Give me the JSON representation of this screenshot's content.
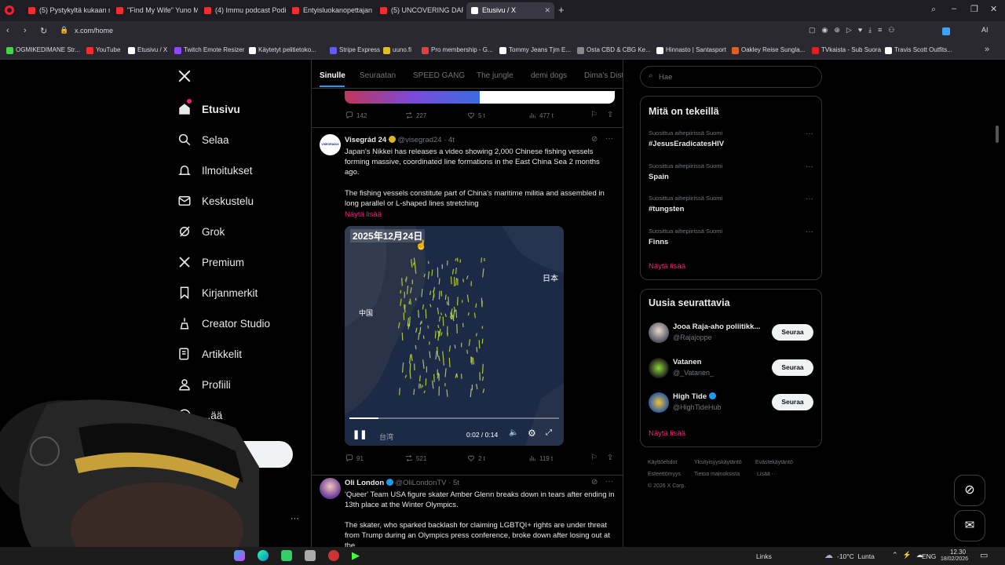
{
  "browser": {
    "tabs": [
      {
        "label": "(5) Pystykyltä kukaan noste",
        "color": "#ff2b2b"
      },
      {
        "label": "\"Find My Wife\" Yuno Mili",
        "color": "#ff2b2b"
      },
      {
        "label": "(4) Immu podcast Podim",
        "color": "#ff2b2b"
      },
      {
        "label": "Entyisluokanopettajan ark",
        "color": "#ff2b2b"
      },
      {
        "label": "(5) UNCOVERING DARK E",
        "color": "#ff2b2b"
      },
      {
        "label": "Etusivu / X",
        "color": "#ffffff"
      }
    ],
    "url": "x.com/home",
    "ai_label": "AI",
    "bookmarks": [
      {
        "label": "OGMIKEDIMANE Str...",
        "color": "#4ad14a"
      },
      {
        "label": "YouTube",
        "color": "#ff2b2b"
      },
      {
        "label": "Etusivu / X",
        "color": "#ffffff"
      },
      {
        "label": "Twitch Emote Resizer",
        "color": "#9146ff"
      },
      {
        "label": "Käytetyt pelitietoko...",
        "color": "#ffffff"
      },
      {
        "label": "Stripe Express",
        "color": "#635bff"
      },
      {
        "label": "uuno.fi",
        "color": "#e0c020"
      },
      {
        "label": "Pro membership - G...",
        "color": "#e04040"
      },
      {
        "label": "Tommy Jeans Tjm E...",
        "color": "#ffffff"
      },
      {
        "label": "Osta CBD & CBG Ke...",
        "color": "#888888"
      },
      {
        "label": "Hinnasto | Santasport",
        "color": "#ffffff"
      },
      {
        "label": "Oakley Reise Sungla...",
        "color": "#e06020"
      },
      {
        "label": "TVkaista - Sub Suora",
        "color": "#e02020"
      },
      {
        "label": "Travis Scott Outfits...",
        "color": "#ffffff"
      }
    ]
  },
  "nav": {
    "items": [
      {
        "label": "Etusivu",
        "icon": "home-icon"
      },
      {
        "label": "Selaa",
        "icon": "search-icon"
      },
      {
        "label": "Ilmoitukset",
        "icon": "bell-icon"
      },
      {
        "label": "Keskustelu",
        "icon": "mail-icon"
      },
      {
        "label": "Grok",
        "icon": "grok-icon"
      },
      {
        "label": "Premium",
        "icon": "x-icon"
      },
      {
        "label": "Kirjanmerkit",
        "icon": "bookmark-icon"
      },
      {
        "label": "Creator Studio",
        "icon": "creator-icon"
      },
      {
        "label": "Artikkelit",
        "icon": "article-icon"
      },
      {
        "label": "Profiili",
        "icon": "person-icon"
      },
      {
        "label": "...ää",
        "icon": "more-icon"
      }
    ],
    "post_button": "...e"
  },
  "feed": {
    "tabs": [
      "Sinulle",
      "Seuraatan",
      "SPEED GANG",
      "The jungle",
      "demi dogs",
      "Dima's Dist"
    ],
    "prev_post_stats": {
      "replies": "142",
      "reposts": "227",
      "likes": "5 t",
      "views": "477 t"
    },
    "post1": {
      "author": "Visegrád 24",
      "handle": "@visegrad24 · 4t",
      "avatar_text": "VISEGRAD24",
      "text1": "Japan's Nikkei has releases a video showing 2,000 Chinese fishing vessels forming massive, coordinated line formations in the East China Sea 2 months ago.",
      "text2": "The fishing vessels constitute part of China's maritime militia and assembled in long parallel or L-shaped lines stretching",
      "show_more": "Näytä lisää",
      "video": {
        "date_overlay": "2025年12月24日",
        "label_japan": "日本",
        "label_china": "中国",
        "label_taiwan": "台湾",
        "time": "0:02 / 0:14",
        "progress": 0.14
      },
      "stats": {
        "replies": "91",
        "reposts": "521",
        "likes": "2 t",
        "views": "119 t"
      }
    },
    "post2": {
      "author": "Oli London",
      "handle": "@OliLondonTV · 5t",
      "text1": "'Queer' Team USA figure skater Amber Glenn breaks down in tears after ending in 13th place at the Winter Olympics.",
      "text2": "The skater, who sparked backlash for claiming LGBTQI+ rights are under threat from Trump during an Olympics press conference, broke down after losing out at the..."
    }
  },
  "sidebar": {
    "search_placeholder": "Hae",
    "trends_title": "Mitä on tekeillä",
    "trends": [
      {
        "category": "Suosittua aihepiirissä Suomi",
        "name": "#JesusEradicatesHIV"
      },
      {
        "category": "Suosittua aihepiirissä Suomi",
        "name": "Spain"
      },
      {
        "category": "Suosittua aihepiirissä Suomi",
        "name": "#tungsten"
      },
      {
        "category": "Suosittua aihepiirissä Suomi",
        "name": "Finns"
      }
    ],
    "show_more": "Näytä lisää",
    "follow_title": "Uusia seurattavia",
    "follow": [
      {
        "name": "Jooa Raja-aho poliitikk...",
        "handle": "@Rajajoppe",
        "button": "Seuraa"
      },
      {
        "name": "Vatanen",
        "handle": "@_Vatanen_",
        "button": "Seuraa"
      },
      {
        "name": "High Tide",
        "handle": "@HighTideHub",
        "button": "Seuraa"
      }
    ],
    "footer": [
      "Käyttöehdot",
      "Yksityisyyskäytäntö",
      "Evästekäytäntö",
      "Esteettömyys",
      "Tietoa mainoksista",
      "Lisää ···",
      "© 2026 X Corp."
    ]
  },
  "taskbar": {
    "links": "Links",
    "weather": "-10°C  Lunta",
    "lang": "ENG",
    "time": "12.30",
    "date": "18/02/2026"
  }
}
